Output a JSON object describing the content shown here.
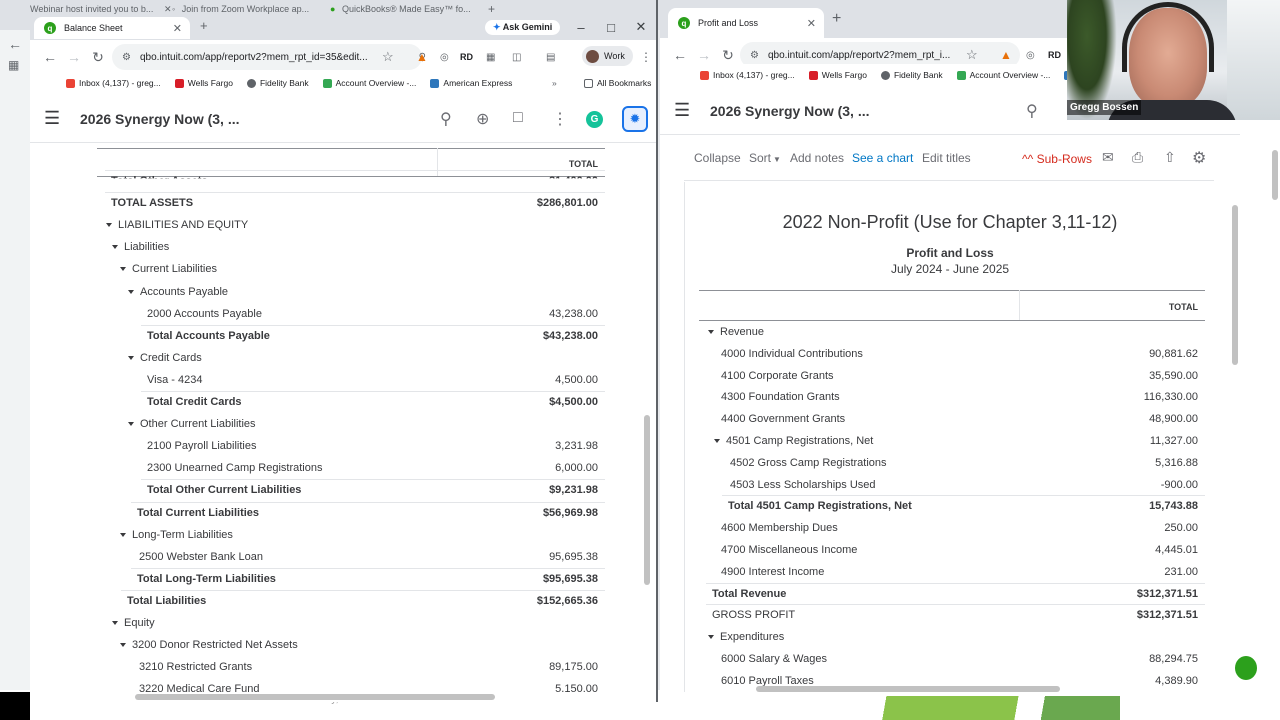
{
  "left_window": {
    "tabs": [
      {
        "title": "Webinar host invited you to b..."
      },
      {
        "title": "Join from Zoom Workplace ap..."
      },
      {
        "title": "QuickBooks® Made Easy™ fo..."
      },
      {
        "title": "Balance Sheet"
      }
    ],
    "ask_gemini": "Ask Gemini",
    "url": "qbo.intuit.com/app/reportv2?mem_rpt_id=35&edit...",
    "profile": "Work",
    "bookmarks": [
      "Inbox (4,137) - greg...",
      "Wells Fargo",
      "Fidelity Bank",
      "Account Overview -...",
      "American Express"
    ],
    "all_bookmarks": "All Bookmarks",
    "company": "2026 Synergy Now (3, ...",
    "col_header": "TOTAL",
    "rows": [
      {
        "label": "Total Other Assets",
        "value": "31,400.00",
        "indent": 14,
        "bold": true,
        "caret": false
      },
      {
        "label": "TOTAL ASSETS",
        "value": "$286,801.00",
        "indent": 14,
        "bold": true,
        "caret": false
      },
      {
        "label": "LIABILITIES AND EQUITY",
        "value": "",
        "indent": 10,
        "bold": false,
        "caret": true
      },
      {
        "label": "Liabilities",
        "value": "",
        "indent": 16,
        "bold": false,
        "caret": true
      },
      {
        "label": "Current Liabilities",
        "value": "",
        "indent": 24,
        "bold": false,
        "caret": true
      },
      {
        "label": "Accounts Payable",
        "value": "",
        "indent": 32,
        "bold": false,
        "caret": true
      },
      {
        "label": "2000 Accounts Payable",
        "value": "43,238.00",
        "indent": 50,
        "bold": false,
        "caret": false
      },
      {
        "label": "Total Accounts Payable",
        "value": "$43,238.00",
        "indent": 50,
        "bold": true,
        "caret": false
      },
      {
        "label": "Credit Cards",
        "value": "",
        "indent": 32,
        "bold": false,
        "caret": true
      },
      {
        "label": "Visa - 4234",
        "value": "4,500.00",
        "indent": 50,
        "bold": false,
        "caret": false
      },
      {
        "label": "Total Credit Cards",
        "value": "$4,500.00",
        "indent": 50,
        "bold": true,
        "caret": false
      },
      {
        "label": "Other Current Liabilities",
        "value": "",
        "indent": 32,
        "bold": false,
        "caret": true
      },
      {
        "label": "2100 Payroll Liabilities",
        "value": "3,231.98",
        "indent": 50,
        "bold": false,
        "caret": false
      },
      {
        "label": "2300 Unearned Camp Registrations",
        "value": "6,000.00",
        "indent": 50,
        "bold": false,
        "caret": false
      },
      {
        "label": "Total Other Current Liabilities",
        "value": "$9,231.98",
        "indent": 50,
        "bold": true,
        "caret": false
      },
      {
        "label": "Total Current Liabilities",
        "value": "$56,969.98",
        "indent": 40,
        "bold": true,
        "caret": false
      },
      {
        "label": "Long-Term Liabilities",
        "value": "",
        "indent": 24,
        "bold": false,
        "caret": true
      },
      {
        "label": "2500 Webster Bank Loan",
        "value": "95,695.38",
        "indent": 42,
        "bold": false,
        "caret": false
      },
      {
        "label": "Total Long-Term Liabilities",
        "value": "$95,695.38",
        "indent": 40,
        "bold": true,
        "caret": false
      },
      {
        "label": "Total Liabilities",
        "value": "$152,665.36",
        "indent": 30,
        "bold": true,
        "caret": false
      },
      {
        "label": "Equity",
        "value": "",
        "indent": 16,
        "bold": false,
        "caret": true
      },
      {
        "label": "3200 Donor Restricted Net Assets",
        "value": "",
        "indent": 24,
        "bold": false,
        "caret": true
      },
      {
        "label": "3210 Restricted Grants",
        "value": "89,175.00",
        "indent": 42,
        "bold": false,
        "caret": false
      },
      {
        "label": "3220 Medical Care Fund",
        "value": "5,150.00",
        "indent": 42,
        "bold": false,
        "caret": false
      }
    ]
  },
  "right_window": {
    "tab_title": "Profit and Loss",
    "url": "qbo.intuit.com/app/reportv2?mem_rpt_i...",
    "bookmarks": [
      "Inbox (4,137) - greg...",
      "Wells Fargo",
      "Fidelity Bank",
      "Account Overview -...",
      "Am"
    ],
    "company": "2026 Synergy Now (3, ...",
    "toolbar": {
      "collapse": "Collapse",
      "sort": "Sort",
      "add_notes": "Add notes",
      "see_chart": "See a chart",
      "edit_titles": "Edit titles",
      "sub_rows": "^^ Sub-Rows"
    },
    "report_title": "2022 Non-Profit (Use for Chapter 3,11-12)",
    "report_subtitle": "Profit and Loss",
    "report_period": "July 2024 - June 2025",
    "col_header": "TOTAL",
    "rows": [
      {
        "label": "Revenue",
        "value": "",
        "indent": 10,
        "bold": false,
        "caret": true
      },
      {
        "label": "4000 Individual Contributions",
        "value": "90,881.62",
        "indent": 22,
        "bold": false,
        "caret": false
      },
      {
        "label": "4100 Corporate Grants",
        "value": "35,590.00",
        "indent": 22,
        "bold": false,
        "caret": false
      },
      {
        "label": "4300 Foundation Grants",
        "value": "116,330.00",
        "indent": 22,
        "bold": false,
        "caret": false
      },
      {
        "label": "4400 Government Grants",
        "value": "48,900.00",
        "indent": 22,
        "bold": false,
        "caret": false
      },
      {
        "label": "4501 Camp Registrations, Net",
        "value": "11,327.00",
        "indent": 16,
        "bold": false,
        "caret": true
      },
      {
        "label": "4502 Gross Camp Registrations",
        "value": "5,316.88",
        "indent": 31,
        "bold": false,
        "caret": false
      },
      {
        "label": "4503 Less Scholarships Used",
        "value": "-900.00",
        "indent": 31,
        "bold": false,
        "caret": false
      },
      {
        "label": "Total 4501 Camp Registrations, Net",
        "value": "15,743.88",
        "indent": 29,
        "bold": true,
        "caret": false
      },
      {
        "label": "4600 Membership Dues",
        "value": "250.00",
        "indent": 22,
        "bold": false,
        "caret": false
      },
      {
        "label": "4700 Miscellaneous Income",
        "value": "4,445.01",
        "indent": 22,
        "bold": false,
        "caret": false
      },
      {
        "label": "4900 Interest Income",
        "value": "231.00",
        "indent": 22,
        "bold": false,
        "caret": false
      },
      {
        "label": "Total Revenue",
        "value": "$312,371.51",
        "indent": 13,
        "bold": true,
        "caret": false
      },
      {
        "label": "GROSS PROFIT",
        "value": "$312,371.51",
        "indent": 13,
        "bold": false,
        "caret": false,
        "bold_value": true
      },
      {
        "label": "Expenditures",
        "value": "",
        "indent": 10,
        "bold": false,
        "caret": true
      },
      {
        "label": "6000 Salary & Wages",
        "value": "88,294.75",
        "indent": 22,
        "bold": false,
        "caret": false
      },
      {
        "label": "6010 Payroll Taxes",
        "value": "4,389.90",
        "indent": 22,
        "bold": false,
        "caret": false
      }
    ]
  },
  "webcam": {
    "name": "Gregg Bossen"
  },
  "bottom_text": "©2021 Barbara Dosalsky, CPA",
  "colors": {
    "qb_green": "#2ca01c",
    "link_blue": "#0077c5",
    "sub_rows_red": "#d52b1e"
  }
}
